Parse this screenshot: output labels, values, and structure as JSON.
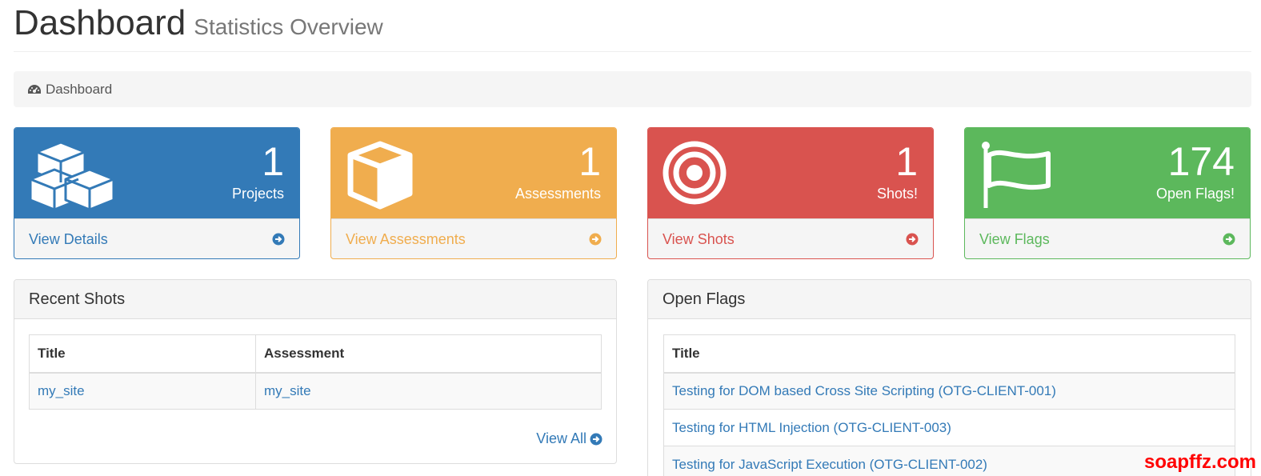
{
  "header": {
    "title": "Dashboard",
    "subtitle": "Statistics Overview"
  },
  "breadcrumb": {
    "icon": "dashboard-icon",
    "label": "Dashboard"
  },
  "stats": {
    "projects": {
      "count": "1",
      "label": "Projects",
      "link": "View Details",
      "icon": "cubes-icon",
      "color": "#337ab7"
    },
    "assessments": {
      "count": "1",
      "label": "Assessments",
      "link": "View Assessments",
      "icon": "cube-icon",
      "color": "#f0ad4e"
    },
    "shots": {
      "count": "1",
      "label": "Shots!",
      "link": "View Shots",
      "icon": "target-icon",
      "color": "#d9534f"
    },
    "flags": {
      "count": "174",
      "label": "Open Flags!",
      "link": "View Flags",
      "icon": "flag-icon",
      "color": "#5cb85c"
    }
  },
  "recent_shots": {
    "title": "Recent Shots",
    "columns": [
      "Title",
      "Assessment"
    ],
    "rows": [
      {
        "title": "my_site",
        "assessment": "my_site"
      }
    ],
    "view_all": "View All"
  },
  "open_flags": {
    "title": "Open Flags",
    "columns": [
      "Title"
    ],
    "rows": [
      "Testing for DOM based Cross Site Scripting (OTG-CLIENT-001)",
      "Testing for HTML Injection (OTG-CLIENT-003)",
      "Testing for JavaScript Execution (OTG-CLIENT-002)"
    ]
  },
  "watermark": "soapffz.com"
}
